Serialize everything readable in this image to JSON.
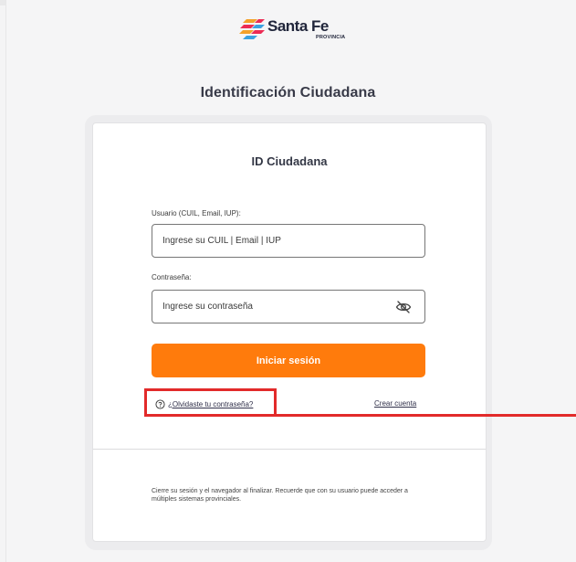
{
  "brand": {
    "name": "Santa Fe",
    "sub": "PROVINCIA"
  },
  "page": {
    "title": "Identificación Ciudadana"
  },
  "card": {
    "title": "ID Ciudadana",
    "user_label": "Usuario (CUIL, Email, IUP):",
    "user_placeholder": "Ingrese su CUIL | Email | IUP",
    "password_label": "Contraseña:",
    "password_placeholder": "Ingrese su contraseña",
    "login_button": "Iniciar sesión",
    "forgot_link": "¿Olvidaste tu contraseña?",
    "create_link": "Crear cuenta",
    "footer_note": "Cierre su sesión y el navegador al finalizar. Recuerde que con su usuario puede acceder a múltiples sistemas provinciales."
  },
  "colors": {
    "accent": "#ff7b0c",
    "highlight": "#e22a2a",
    "brand_navy": "#21263b"
  },
  "icons": {
    "password_toggle": "eye-off-icon",
    "help": "question-circle-icon",
    "logo": "santa-fe-flag-icon"
  }
}
